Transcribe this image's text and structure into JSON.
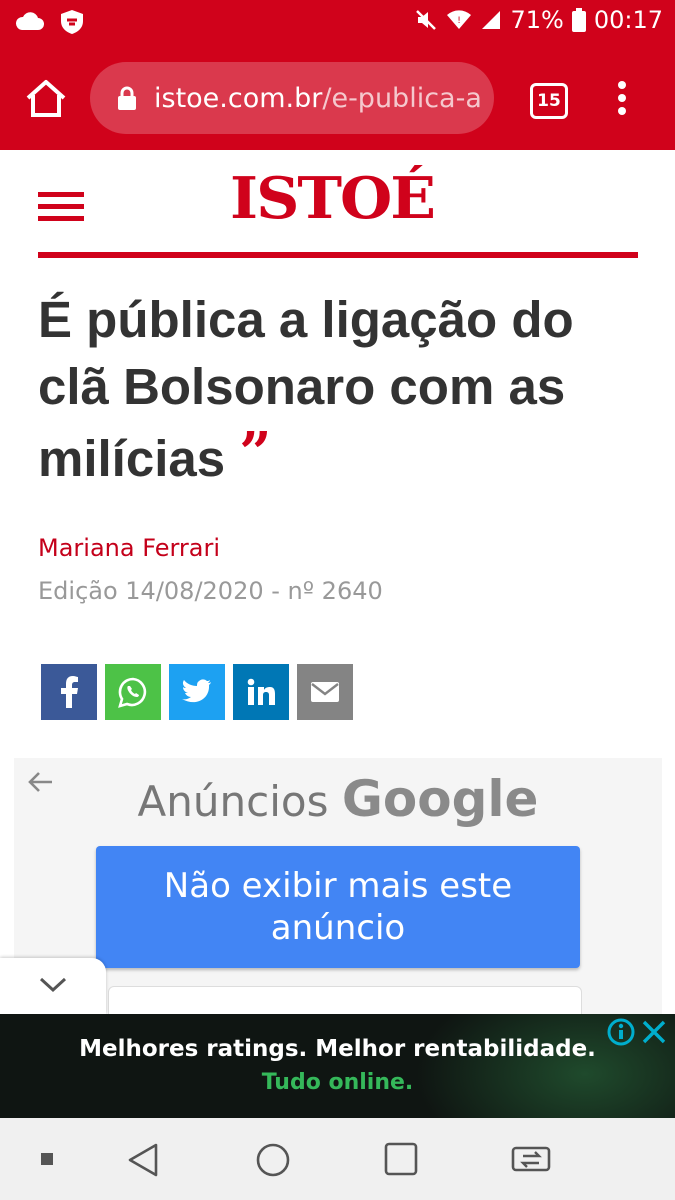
{
  "status_bar": {
    "battery": "71%",
    "time": "00:17",
    "icons": [
      "cloud-icon",
      "shield-icon",
      "mute-icon",
      "wifi-icon",
      "signal-icon",
      "battery-icon"
    ]
  },
  "browser": {
    "url_domain": "istoe.com.br",
    "url_path": "/e-publica-a",
    "tab_count": "15"
  },
  "site": {
    "logo": "ISTOÉ",
    "brand_color": "#d0021b"
  },
  "article": {
    "headline": "É pública a ligação do clã Bolsonaro com as milícias",
    "quote_mark": "”",
    "author": "Mariana Ferrari",
    "edition": "Edição 14/08/2020 - nº 2640"
  },
  "share": {
    "buttons": [
      {
        "name": "facebook",
        "color": "#3b5998"
      },
      {
        "name": "whatsapp",
        "color": "#4dc247"
      },
      {
        "name": "twitter",
        "color": "#1da1f2"
      },
      {
        "name": "linkedin",
        "color": "#0077b5"
      },
      {
        "name": "email",
        "color": "#848484"
      }
    ]
  },
  "ad_panel": {
    "label": "Anúncios",
    "brand": "Google",
    "stop_button": "Não exibir mais este anúncio"
  },
  "banner_ad": {
    "line1": "Melhores ratings. Melhor rentabilidade.",
    "line2": "Tudo online."
  }
}
